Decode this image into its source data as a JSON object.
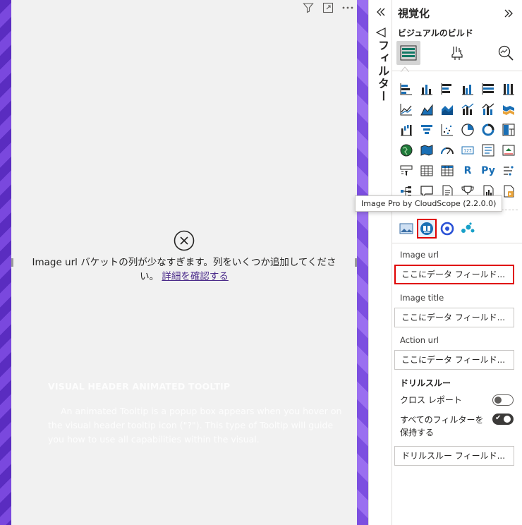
{
  "canvas": {
    "error_message": "Image url バケットの列が少なすぎます。列をいくつか追加してください。",
    "error_link": "詳細を確認する",
    "ghost_title": "VISUAL HEADER ANIMATED TOOLTIP",
    "ghost_body": "An animated Tooltip is a popup box appears when you hover on the visual header tooltip icon (\"?\"). This type of Tooltip will guide you how to use all capabilities within the visual."
  },
  "filter_pane": {
    "label": "フィルター"
  },
  "viz_pane": {
    "title": "視覚化",
    "subtitle": "ビジュアルのビルド",
    "tooltip": "Image Pro by CloudScope (2.2.0.0)",
    "fields": {
      "image_url": {
        "label": "Image url",
        "placeholder": "ここにデータ フィールド..."
      },
      "image_title": {
        "label": "Image title",
        "placeholder": "ここにデータ フィールド..."
      },
      "action_url": {
        "label": "Action url",
        "placeholder": "ここにデータ フィールド..."
      }
    },
    "drill": {
      "title": "ドリルスルー",
      "cross_report": "クロス レポート",
      "cross_report_on": false,
      "keep_filters": "すべてのフィルターを保持する",
      "keep_filters_on": true,
      "field_placeholder": "ドリルスルー フィールド..."
    },
    "text_icons": {
      "r": "R",
      "py": "Py"
    }
  },
  "colors": {
    "accent_blue": "#1a6fb5",
    "highlight_red": "#e00000",
    "canvas_purple": "#6a3ad0"
  }
}
